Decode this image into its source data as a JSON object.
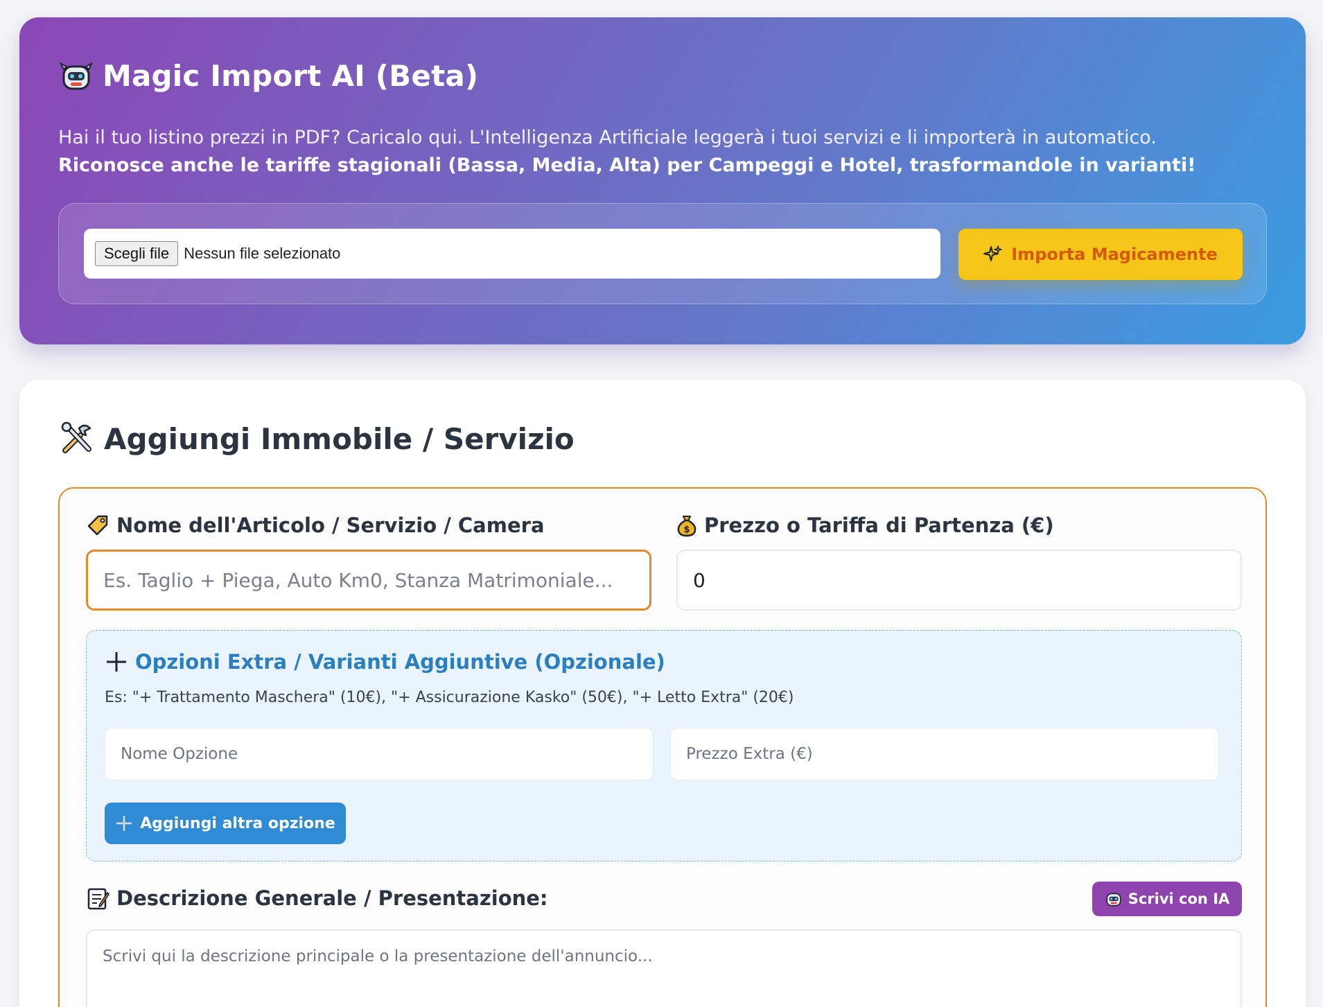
{
  "magic_import": {
    "title": "Magic Import AI (Beta)",
    "description_plain": "Hai il tuo listino prezzi in PDF? Caricalo qui. L'Intelligenza Artificiale leggerà i tuoi servizi e li importerà in automatico.",
    "description_bold": "Riconosce anche le tariffe stagionali (Bassa, Media, Alta) per Campeggi e Hotel, trasformandole in varianti!",
    "file_button_label": "Scegli file",
    "file_status": "Nessun file selezionato",
    "import_button_label": "Importa Magicamente",
    "icons": {
      "title": "robot-icon",
      "import": "sparkles-icon"
    }
  },
  "add_item": {
    "title": "Aggiungi Immobile / Servizio",
    "name_label": "Nome dell'Articolo / Servizio / Camera",
    "name_placeholder": "Es. Taglio + Piega, Auto Km0, Stanza Matrimoniale...",
    "price_label": "Prezzo o Tariffa di Partenza (€)",
    "price_value": "0",
    "extras": {
      "title": "Opzioni Extra / Varianti Aggiuntive (Opzionale)",
      "example": "Es: \"+ Trattamento Maschera\" (10€), \"+ Assicurazione Kasko\" (50€), \"+ Letto Extra\" (20€)",
      "option_name_placeholder": "Nome Opzione",
      "option_price_placeholder": "Prezzo Extra (€)",
      "add_option_label": "Aggiungi altra opzione"
    },
    "description_label": "Descrizione Generale / Presentazione:",
    "ai_write_label": "Scrivi con IA",
    "description_placeholder": "Scrivi qui la descrizione principale o la presentazione dell'annuncio..."
  },
  "colors": {
    "accent_orange": "#e08a2c",
    "import_yellow": "#f5c518",
    "blue": "#2f8bd4",
    "purple": "#8e44ad"
  }
}
